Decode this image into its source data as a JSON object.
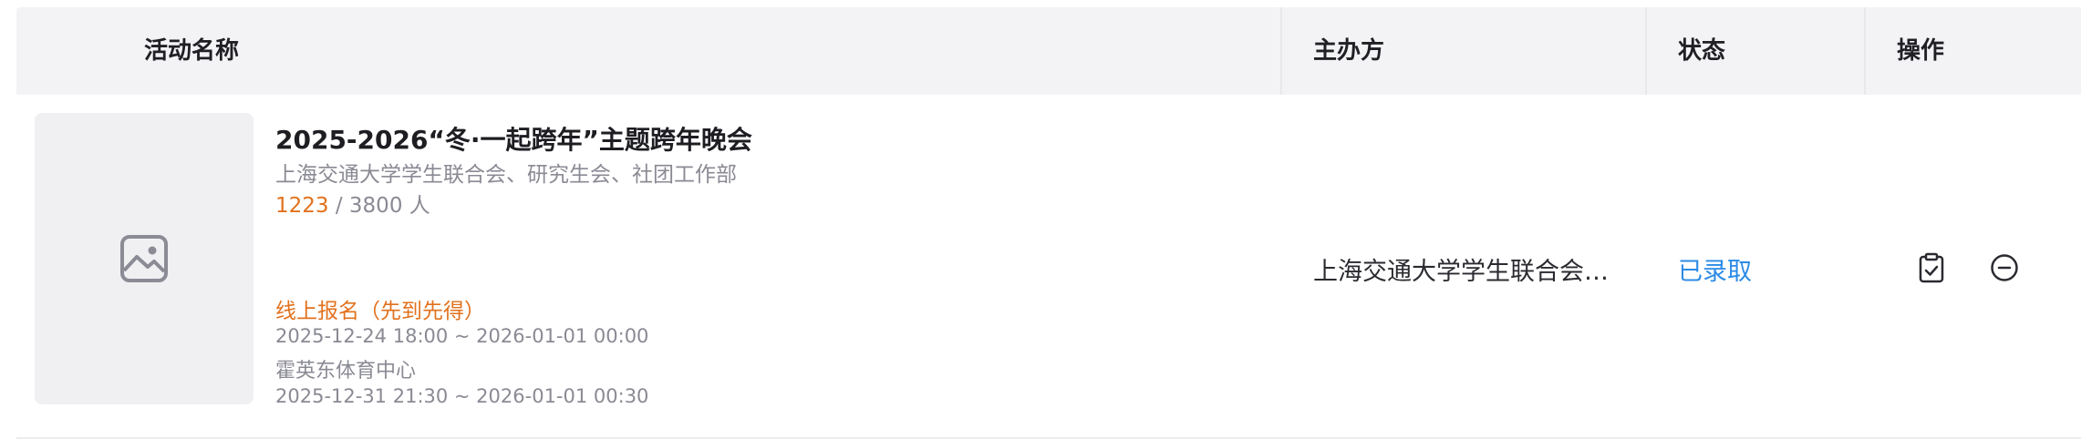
{
  "table": {
    "headers": {
      "name": "活动名称",
      "host": "主办方",
      "status": "状态",
      "actions": "操作"
    },
    "rows": [
      {
        "thumbnail_icon": "image-placeholder-icon",
        "title": "2025-2026“冬·一起跨年”主题跨年晚会",
        "organizers": "上海交通大学学生联合会、研究生会、社团工作部",
        "enrolled": "1223",
        "capacity": " / 3800 人",
        "signup_type": "线上报名（先到先得）",
        "signup_time": "2025-12-24 18:00 ~ 2026-01-01 00:00",
        "venue": "霍英东体育中心",
        "event_time": "2025-12-31 21:30 ~ 2026-01-01 00:30",
        "host": "上海交通大学学生联合会、研究生会、社团工作部",
        "status": "已录取",
        "action_icons": [
          "clipboard-check-icon",
          "minus-circle-icon"
        ]
      }
    ]
  },
  "colors": {
    "header_bg": "#f3f3f6",
    "accent_orange": "#e2711d",
    "status_blue": "#2b8be6",
    "muted_text": "#8a8a94"
  }
}
